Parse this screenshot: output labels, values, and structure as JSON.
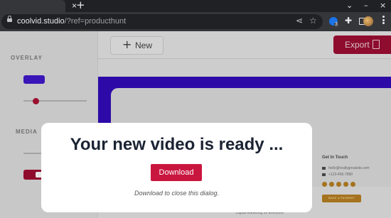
{
  "browser": {
    "tab_close": "×",
    "new_tab": "+",
    "controls": {
      "chevron": "⌄",
      "minimize": "–",
      "close": "×"
    },
    "url_host": "coolvid.studio",
    "url_rest": "/?ref=producthunt",
    "extension_count": "3"
  },
  "sidebar": {
    "overlay_label": "OVERLAY",
    "media_label": "MEDIA",
    "overlay_color": "#3a15b8"
  },
  "topbar": {
    "new_label": "New",
    "export_label": "Export"
  },
  "preview": {
    "touch_title": "Get In Touch",
    "email": "hello@reallygreatsite.com",
    "phone": "+123-456-7890",
    "button_label": "MAKE A PAYMENT",
    "bottom_text": "Digital Marketing for Everyone"
  },
  "dialog": {
    "title": "Your new video is ready ...",
    "download_label": "Download",
    "hint": "Download to close this dialog."
  },
  "colors": {
    "accent": "#c9163f",
    "video_bg": "#2d0aa8",
    "gold": "#a5731e"
  }
}
